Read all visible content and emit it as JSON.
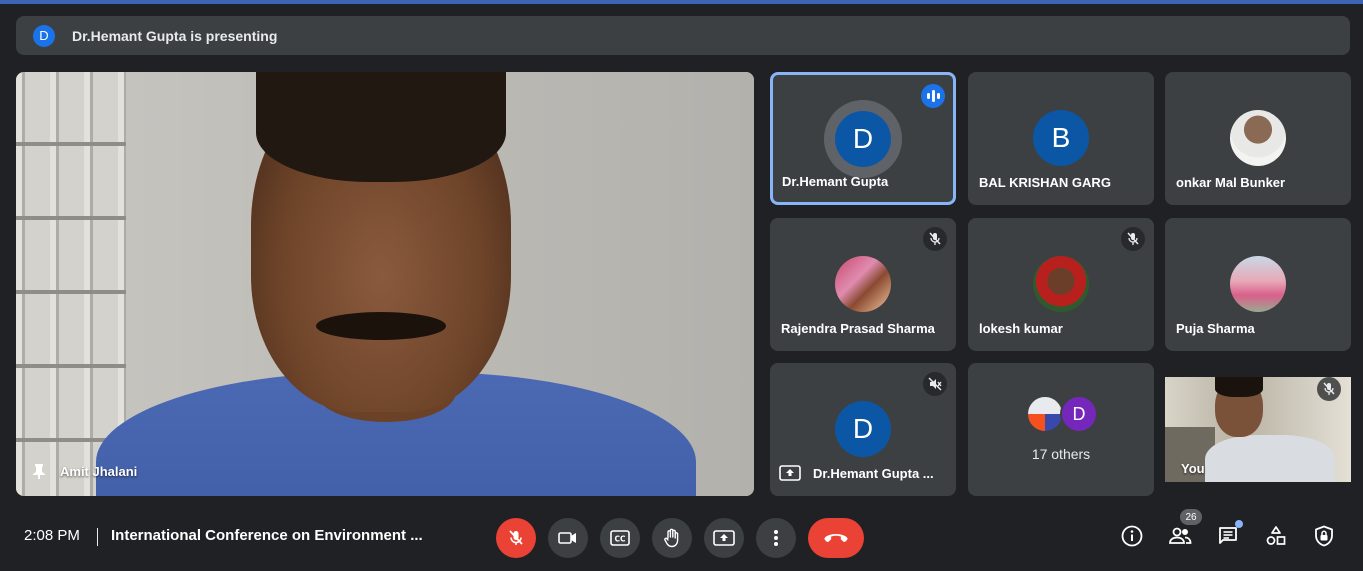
{
  "banner": {
    "avatar_letter": "D",
    "text": "Dr.Hemant Gupta is presenting"
  },
  "main_tile": {
    "name": "Amit Jhalani"
  },
  "tiles": [
    {
      "name": "Dr.Hemant Gupta",
      "avatar_letter": "D",
      "speaking": true
    },
    {
      "name": "BAL KRISHAN GARG",
      "avatar_letter": "B"
    },
    {
      "name": "onkar Mal Bunker",
      "photo": true
    },
    {
      "name": "Rajendra Prasad Sharma",
      "photo": true,
      "muted": true
    },
    {
      "name": "lokesh kumar",
      "photo": true,
      "muted": true
    },
    {
      "name": "Puja Sharma",
      "photo": true
    },
    {
      "name": "Dr.Hemant Gupta ...",
      "avatar_letter": "D",
      "presenting": true
    },
    {
      "name": "",
      "others_count": "17 others",
      "others_letter": "D"
    },
    {
      "name": "You",
      "self_video": true,
      "muted": true
    }
  ],
  "bottom": {
    "time": "2:08 PM",
    "meeting_title": "International Conference on Environment ...",
    "participants_count": "26"
  },
  "colors": {
    "accent": "#8ab4f8",
    "end_call": "#ea4335",
    "tile_bg": "#3c4043",
    "avatar_blue": "#0b57a6"
  }
}
